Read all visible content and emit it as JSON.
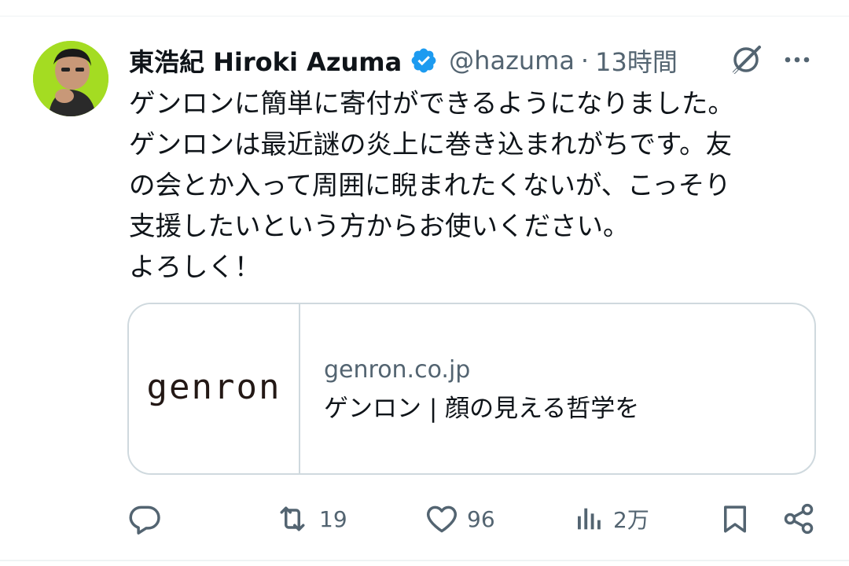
{
  "tweet": {
    "author_name": "東浩紀 Hiroki Azuma",
    "handle": "@hazuma",
    "separator": "·",
    "time": "13時間",
    "body_lines": [
      "ゲンロンに簡単に寄付ができるようになりました。",
      "ゲンロンは最近謎の炎上に巻き込まれがちです。友",
      "の会とか入って周囲に睨まれたくないが、こっそり",
      "支援したいという方からお使いください。",
      "よろしく！"
    ]
  },
  "card": {
    "logo_text": "genron",
    "domain": "genron.co.jp",
    "title": "ゲンロン | 顔の見える哲学を"
  },
  "actions": {
    "reply_count": "",
    "retweet_count": "19",
    "like_count": "96",
    "views_count": "2万"
  },
  "icons": {
    "verified": "verified-badge-icon",
    "grok": "grok-icon",
    "more": "more-icon",
    "reply": "reply-icon",
    "retweet": "retweet-icon",
    "like": "heart-icon",
    "views": "views-icon",
    "bookmark": "bookmark-icon",
    "share": "share-icon"
  },
  "colors": {
    "verified_blue": "#1d9bf0",
    "text_primary": "#0f1419",
    "text_secondary": "#536471",
    "border": "#cfd9de"
  }
}
